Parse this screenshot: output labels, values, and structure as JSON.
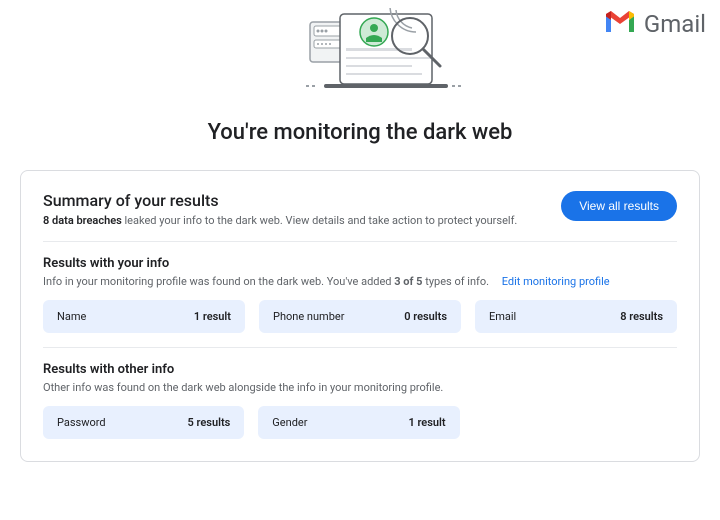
{
  "brand": {
    "name": "Gmail"
  },
  "hero": {
    "title": "You're monitoring the dark web"
  },
  "summary": {
    "title": "Summary of your results",
    "strong": "8 data breaches",
    "rest": " leaked your info to the dark web. View details and take action to protect yourself.",
    "button": "View all results"
  },
  "section1": {
    "title": "Results with your info",
    "sub_before": "Info in your monitoring profile was found on the dark web. You've added ",
    "sub_strong": "3 of 5",
    "sub_after": " types of info.",
    "edit": "Edit monitoring profile",
    "chips": [
      {
        "label": "Name",
        "count": "1 result"
      },
      {
        "label": "Phone number",
        "count": "0 results"
      },
      {
        "label": "Email",
        "count": "8 results"
      }
    ]
  },
  "section2": {
    "title": "Results with other info",
    "sub": "Other info was found on the dark web alongside the info in your monitoring profile.",
    "chips": [
      {
        "label": "Password",
        "count": "5 results"
      },
      {
        "label": "Gender",
        "count": "1 result"
      }
    ]
  }
}
